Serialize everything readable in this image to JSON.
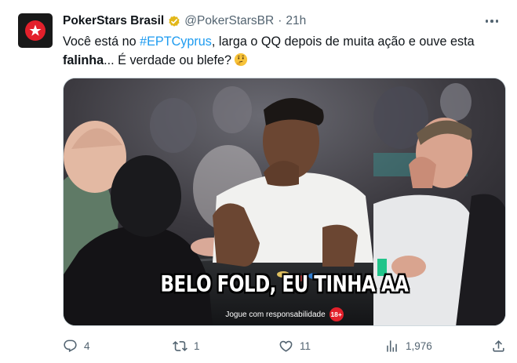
{
  "tweet": {
    "author_name": "PokerStars Brasil",
    "handle": "@PokerStarsBR",
    "separator": "·",
    "time": "21h",
    "text": {
      "part1": "Você está no ",
      "hashtag": "#EPTCyprus",
      "part2": ", larga o QQ depois de muita ação e ouve esta ",
      "bold": "falinha",
      "part3": "... É verdade ou blefe?"
    },
    "emoji": "thinking-face-emoji"
  },
  "media": {
    "caption": "BELO FOLD, EU TINHA AA",
    "disclaimer": "Jogue com responsabilidade",
    "age_badge": "18+"
  },
  "actions": {
    "replies": "4",
    "reposts": "1",
    "likes": "11",
    "views": "1,976"
  },
  "icons": {
    "avatar": "pokerstars-logo-icon",
    "verified": "gold-verified-badge-icon",
    "more": "more-options-icon",
    "reply": "reply-icon",
    "repost": "repost-icon",
    "like": "like-icon",
    "views": "views-icon",
    "share": "share-icon"
  },
  "colors": {
    "text": "#0f1419",
    "secondary": "#536471",
    "hashtag": "#1d9bf0",
    "verified_gold": "#e2b719",
    "brand_red": "#e3202b"
  }
}
